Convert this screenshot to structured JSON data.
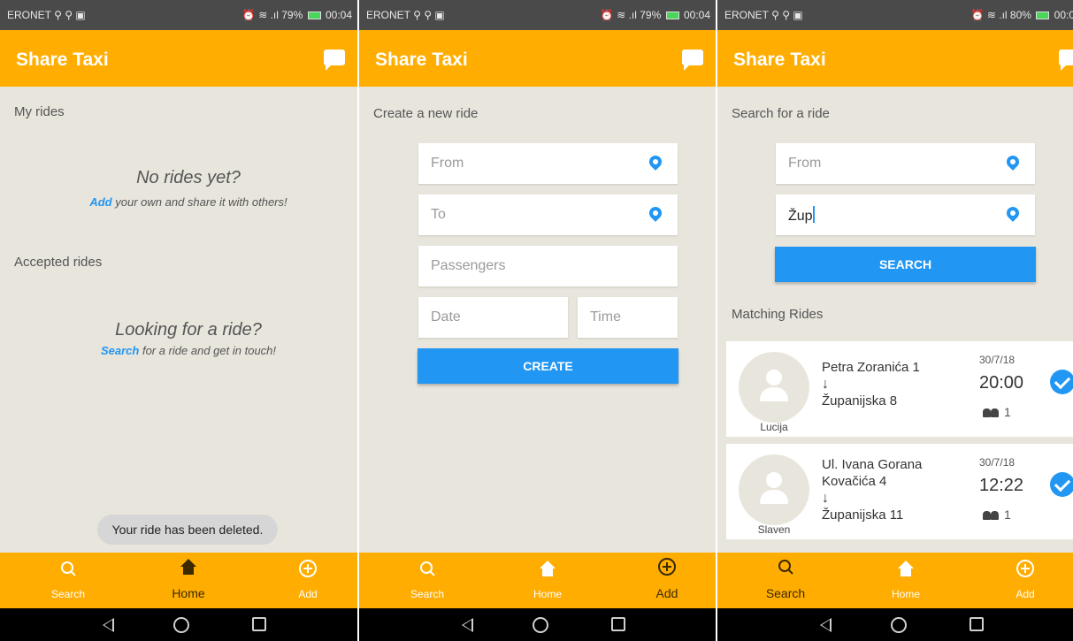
{
  "status_bar": [
    {
      "carrier": "ERONET ⚲ ⚲ ▣",
      "status": "⏰ ≋ .ıl 79%",
      "time": "00:04"
    },
    {
      "carrier": "ERONET ⚲ ⚲ ▣",
      "status": "⏰ ≋ .ıl 79%",
      "time": "00:04"
    },
    {
      "carrier": "ERONET ⚲ ⚲ ▣",
      "status": "⏰ ≋ .ıl 80%",
      "time": "00:0"
    }
  ],
  "app": {
    "title": "Share Taxi"
  },
  "nav": {
    "search": "Search",
    "home": "Home",
    "add": "Add"
  },
  "home_screen": {
    "my_rides_label": "My rides",
    "no_rides_title": "No rides yet?",
    "no_rides_link": "Add",
    "no_rides_text": "your own and share it with others!",
    "accepted_label": "Accepted rides",
    "looking_title": "Looking for a ride?",
    "looking_link": "Search",
    "looking_text": "for a ride and get in touch!",
    "toast": "Your ride has been deleted."
  },
  "create_screen": {
    "heading": "Create a new ride",
    "from_placeholder": "From",
    "to_placeholder": "To",
    "passengers_placeholder": "Passengers",
    "date_placeholder": "Date",
    "time_placeholder": "Time",
    "create_button": "CREATE"
  },
  "search_screen": {
    "heading": "Search for a ride",
    "from_placeholder": "From",
    "to_value": "Žup",
    "search_button": "SEARCH",
    "matching_label": "Matching Rides",
    "rides": [
      {
        "driver": "Lucija",
        "from": "Petra Zoranića 1",
        "to": "Županijska 8",
        "date": "30/7/18",
        "time": "20:00",
        "passengers": "1"
      },
      {
        "driver": "Slaven",
        "from": "Ul. Ivana Gorana Kovačića 4",
        "to": "Županijska 11",
        "date": "30/7/18",
        "time": "12:22",
        "passengers": "1"
      }
    ]
  },
  "colors": {
    "app_bar": "#ffad00",
    "accent": "#2196f3",
    "background": "#e8e5dc"
  }
}
